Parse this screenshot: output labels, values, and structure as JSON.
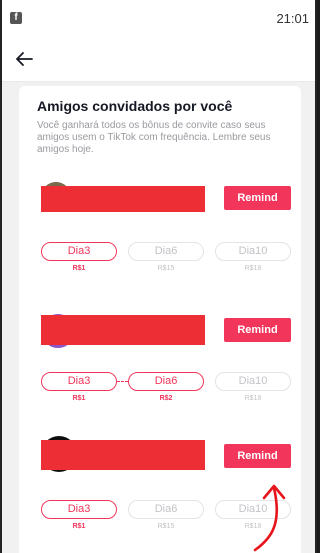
{
  "status_bar": {
    "time": "21:01",
    "left_icon": "f",
    "left_icon_name": "facebook-notification-icon"
  },
  "nav": {
    "back_icon": "arrow-left-icon"
  },
  "card": {
    "title": "Amigos convidados por você",
    "subtitle": "Você ganhará todos os bônus de convite caso seus amigos usem o TikTok com frequência. Lembre seus amigos hoje."
  },
  "friends": [
    {
      "remind_label": "Remind",
      "days": [
        {
          "label": "Dia3",
          "reward": "R$1",
          "done": true
        },
        {
          "label": "Dia6",
          "reward": "R$15",
          "done": false
        },
        {
          "label": "Dia10",
          "reward": "R$18",
          "done": false
        }
      ]
    },
    {
      "remind_label": "Remind",
      "days": [
        {
          "label": "Dia3",
          "reward": "R$1",
          "done": true
        },
        {
          "label": "Dia6",
          "reward": "R$2",
          "done": true
        },
        {
          "label": "Dia10",
          "reward": "R$18",
          "done": false
        }
      ]
    },
    {
      "remind_label": "Remind",
      "days": [
        {
          "label": "Dia3",
          "reward": "R$1",
          "done": true
        },
        {
          "label": "Dia6",
          "reward": "R$15",
          "done": false
        },
        {
          "label": "Dia10",
          "reward": "R$18",
          "done": false
        }
      ]
    }
  ],
  "colors": {
    "accent": "#f2355b",
    "redaction": "#ee2e35",
    "annotation_arrow": "#e8141c",
    "inactive_text": "#c3c3c7"
  }
}
